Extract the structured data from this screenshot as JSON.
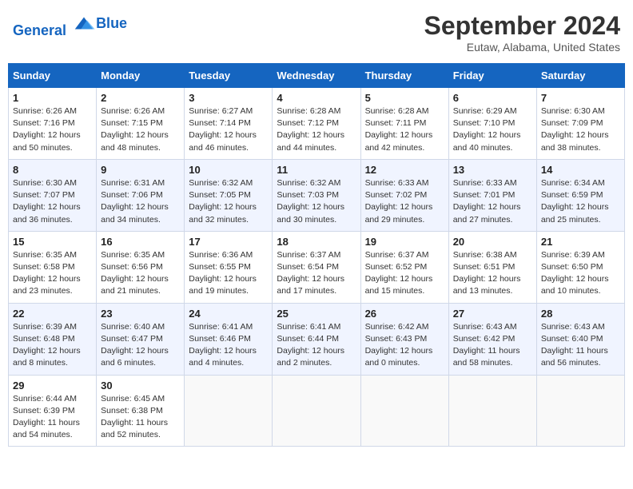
{
  "header": {
    "logo_line1": "General",
    "logo_line2": "Blue",
    "month": "September 2024",
    "location": "Eutaw, Alabama, United States"
  },
  "days_of_week": [
    "Sunday",
    "Monday",
    "Tuesday",
    "Wednesday",
    "Thursday",
    "Friday",
    "Saturday"
  ],
  "weeks": [
    [
      {
        "day": "1",
        "sunrise": "6:26 AM",
        "sunset": "7:16 PM",
        "daylight": "12 hours and 50 minutes."
      },
      {
        "day": "2",
        "sunrise": "6:26 AM",
        "sunset": "7:15 PM",
        "daylight": "12 hours and 48 minutes."
      },
      {
        "day": "3",
        "sunrise": "6:27 AM",
        "sunset": "7:14 PM",
        "daylight": "12 hours and 46 minutes."
      },
      {
        "day": "4",
        "sunrise": "6:28 AM",
        "sunset": "7:12 PM",
        "daylight": "12 hours and 44 minutes."
      },
      {
        "day": "5",
        "sunrise": "6:28 AM",
        "sunset": "7:11 PM",
        "daylight": "12 hours and 42 minutes."
      },
      {
        "day": "6",
        "sunrise": "6:29 AM",
        "sunset": "7:10 PM",
        "daylight": "12 hours and 40 minutes."
      },
      {
        "day": "7",
        "sunrise": "6:30 AM",
        "sunset": "7:09 PM",
        "daylight": "12 hours and 38 minutes."
      }
    ],
    [
      {
        "day": "8",
        "sunrise": "6:30 AM",
        "sunset": "7:07 PM",
        "daylight": "12 hours and 36 minutes."
      },
      {
        "day": "9",
        "sunrise": "6:31 AM",
        "sunset": "7:06 PM",
        "daylight": "12 hours and 34 minutes."
      },
      {
        "day": "10",
        "sunrise": "6:32 AM",
        "sunset": "7:05 PM",
        "daylight": "12 hours and 32 minutes."
      },
      {
        "day": "11",
        "sunrise": "6:32 AM",
        "sunset": "7:03 PM",
        "daylight": "12 hours and 30 minutes."
      },
      {
        "day": "12",
        "sunrise": "6:33 AM",
        "sunset": "7:02 PM",
        "daylight": "12 hours and 29 minutes."
      },
      {
        "day": "13",
        "sunrise": "6:33 AM",
        "sunset": "7:01 PM",
        "daylight": "12 hours and 27 minutes."
      },
      {
        "day": "14",
        "sunrise": "6:34 AM",
        "sunset": "6:59 PM",
        "daylight": "12 hours and 25 minutes."
      }
    ],
    [
      {
        "day": "15",
        "sunrise": "6:35 AM",
        "sunset": "6:58 PM",
        "daylight": "12 hours and 23 minutes."
      },
      {
        "day": "16",
        "sunrise": "6:35 AM",
        "sunset": "6:56 PM",
        "daylight": "12 hours and 21 minutes."
      },
      {
        "day": "17",
        "sunrise": "6:36 AM",
        "sunset": "6:55 PM",
        "daylight": "12 hours and 19 minutes."
      },
      {
        "day": "18",
        "sunrise": "6:37 AM",
        "sunset": "6:54 PM",
        "daylight": "12 hours and 17 minutes."
      },
      {
        "day": "19",
        "sunrise": "6:37 AM",
        "sunset": "6:52 PM",
        "daylight": "12 hours and 15 minutes."
      },
      {
        "day": "20",
        "sunrise": "6:38 AM",
        "sunset": "6:51 PM",
        "daylight": "12 hours and 13 minutes."
      },
      {
        "day": "21",
        "sunrise": "6:39 AM",
        "sunset": "6:50 PM",
        "daylight": "12 hours and 10 minutes."
      }
    ],
    [
      {
        "day": "22",
        "sunrise": "6:39 AM",
        "sunset": "6:48 PM",
        "daylight": "12 hours and 8 minutes."
      },
      {
        "day": "23",
        "sunrise": "6:40 AM",
        "sunset": "6:47 PM",
        "daylight": "12 hours and 6 minutes."
      },
      {
        "day": "24",
        "sunrise": "6:41 AM",
        "sunset": "6:46 PM",
        "daylight": "12 hours and 4 minutes."
      },
      {
        "day": "25",
        "sunrise": "6:41 AM",
        "sunset": "6:44 PM",
        "daylight": "12 hours and 2 minutes."
      },
      {
        "day": "26",
        "sunrise": "6:42 AM",
        "sunset": "6:43 PM",
        "daylight": "12 hours and 0 minutes."
      },
      {
        "day": "27",
        "sunrise": "6:43 AM",
        "sunset": "6:42 PM",
        "daylight": "11 hours and 58 minutes."
      },
      {
        "day": "28",
        "sunrise": "6:43 AM",
        "sunset": "6:40 PM",
        "daylight": "11 hours and 56 minutes."
      }
    ],
    [
      {
        "day": "29",
        "sunrise": "6:44 AM",
        "sunset": "6:39 PM",
        "daylight": "11 hours and 54 minutes."
      },
      {
        "day": "30",
        "sunrise": "6:45 AM",
        "sunset": "6:38 PM",
        "daylight": "11 hours and 52 minutes."
      },
      null,
      null,
      null,
      null,
      null
    ]
  ]
}
